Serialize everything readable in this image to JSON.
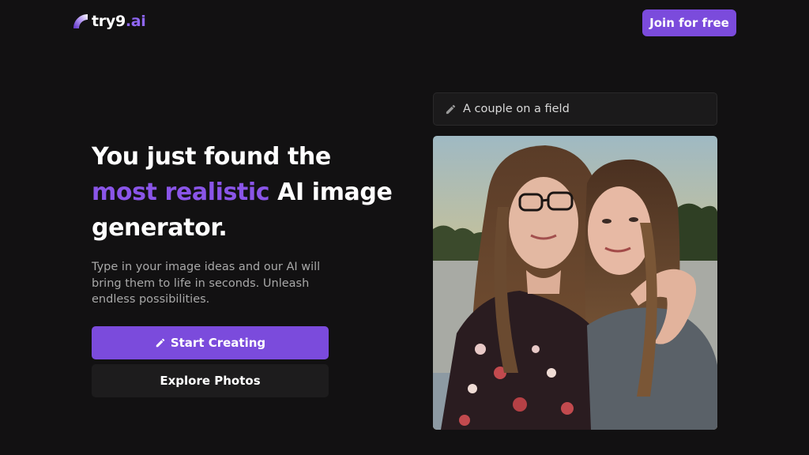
{
  "header": {
    "logo_main": "try9",
    "logo_suffix": ".ai",
    "join_label": "Join for free"
  },
  "hero": {
    "headline_line1": "You just found the",
    "headline_accent": "most realistic",
    "headline_rest": " AI image",
    "headline_line3": "generator.",
    "subtext": "Type in your image ideas and our AI will bring them to life in seconds. Unleash endless possibilities.",
    "start_label": "Start Creating",
    "explore_label": "Explore Photos"
  },
  "prompt": {
    "text": "A couple on a field"
  },
  "icons": {
    "logo": "try9-logo-icon",
    "pencil": "pencil-icon"
  },
  "colors": {
    "background": "#121112",
    "accent": "#7b4bdc",
    "accent_text": "#8a55e8",
    "secondary_button": "#1d1c1d"
  }
}
